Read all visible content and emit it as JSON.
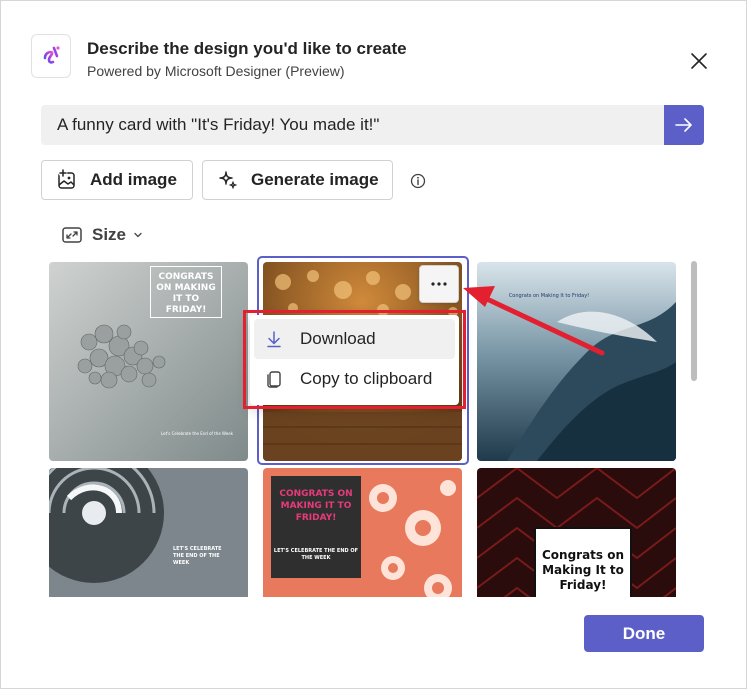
{
  "header": {
    "title": "Describe the design you'd like to create",
    "subtitle": "Powered by Microsoft Designer (Preview)",
    "logo_icon": "designer-logo-icon",
    "close_icon": "close-icon"
  },
  "prompt": {
    "value": "A funny card with \"It's Friday! You made it!\"",
    "send_icon": "arrow-right-icon"
  },
  "actions": {
    "add_image_label": "Add image",
    "generate_image_label": "Generate image",
    "info_icon": "info-icon"
  },
  "size": {
    "label": "Size"
  },
  "cards": [
    {
      "text": "CONGRATS ON MAKING IT TO FRIDAY!",
      "caption": "Let's Celebrate the End of the Week"
    },
    {
      "text": ""
    },
    {
      "text": "Congrats on Making It to Friday!"
    },
    {
      "text": "LET'S CELEBRATE THE END OF THE WEEK"
    },
    {
      "text": "CONGRATS ON MAKING IT TO FRIDAY!",
      "caption": "LET'S CELEBRATE THE END OF THE WEEK"
    },
    {
      "text": "Congrats on Making It to Friday!"
    }
  ],
  "menu": {
    "items": [
      {
        "label": "Download",
        "icon": "download-icon"
      },
      {
        "label": "Copy to clipboard",
        "icon": "copy-icon"
      }
    ]
  },
  "footer": {
    "done_label": "Done"
  },
  "colors": {
    "accent": "#5b5fc7",
    "annotation_red": "#e3202f"
  }
}
